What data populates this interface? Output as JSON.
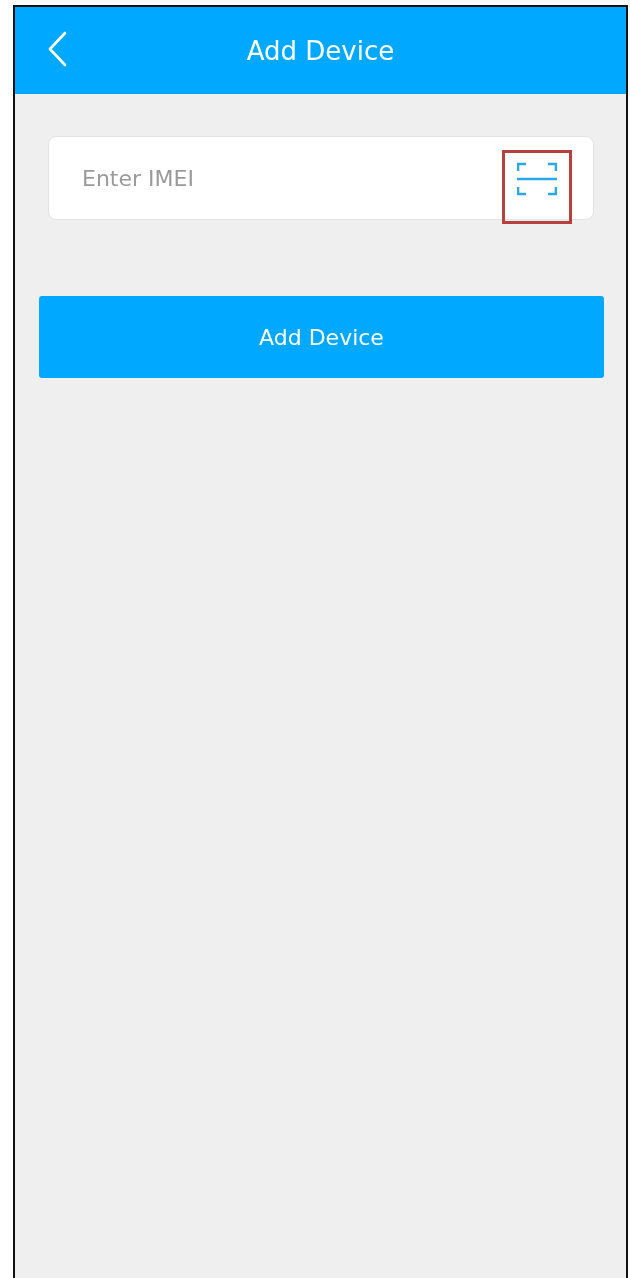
{
  "header": {
    "title": "Add Device"
  },
  "imei_field": {
    "placeholder": "Enter IMEI"
  },
  "add_button": {
    "label": "Add Device"
  }
}
